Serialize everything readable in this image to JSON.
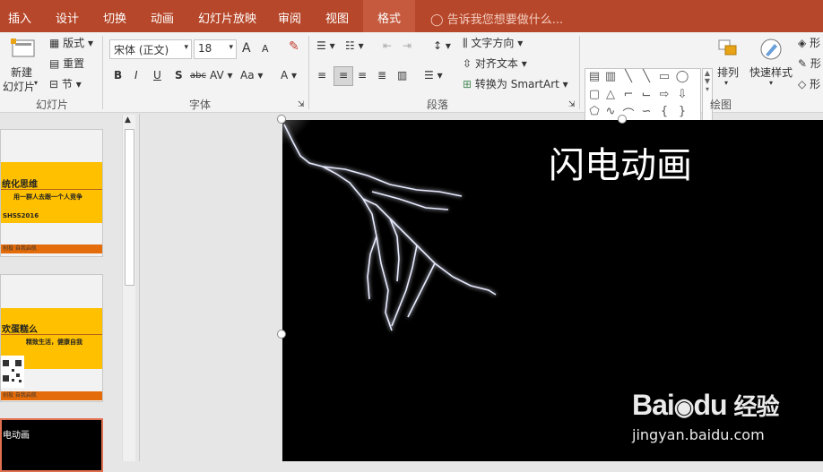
{
  "tabs": [
    "插入",
    "设计",
    "切换",
    "动画",
    "幻灯片放映",
    "审阅",
    "视图",
    "格式"
  ],
  "active_tab": "格式",
  "tell_me": "告诉我您想要做什么...",
  "ribbon": {
    "slides": {
      "new_slide": "新建",
      "new_slide2": "幻灯片",
      "layout": "版式",
      "reset": "重置",
      "section": "节",
      "group_label": "幻灯片"
    },
    "font": {
      "font_name": "宋体 (正文)",
      "font_size": "18",
      "bold": "B",
      "italic": "I",
      "underline": "U",
      "shadow": "S",
      "strike": "abc",
      "spacing": "AV",
      "case": "Aa",
      "color": "A",
      "grow": "A",
      "shrink": "A",
      "group_label": "字体"
    },
    "paragraph": {
      "text_direction": "文字方向",
      "align_text": "对齐文本",
      "convert_smartart": "转换为 SmartArt",
      "group_label": "段落"
    },
    "drawing": {
      "arrange": "排列",
      "quick_styles": "快速样式",
      "shape_fill": "形",
      "shape_outline": "形",
      "shape_effects": "形",
      "group_label": "绘图"
    }
  },
  "thumbnails": [
    {
      "title": "统化思维",
      "subtitle": "用一群人去跟一个人竞争",
      "code": "SHSS2016",
      "footer": "创投 自我启航"
    },
    {
      "title": "欢蛋糕么",
      "subtitle": "精致生活，健康自我",
      "footer": "创投 自我启航"
    },
    {
      "title": "电动画"
    }
  ],
  "slide": {
    "title": "闪电动画"
  },
  "watermark": {
    "brand": "Bai",
    "brand2": "du",
    "suffix": "经验",
    "url": "jingyan.baidu.com"
  }
}
